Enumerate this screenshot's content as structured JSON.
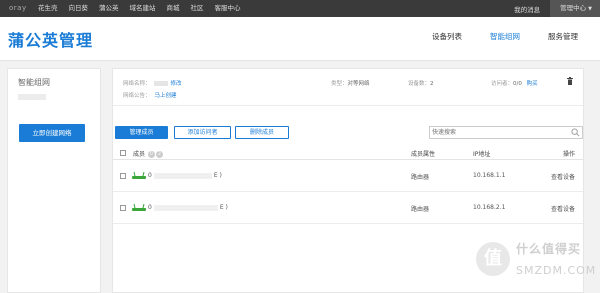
{
  "topbar": {
    "logo": "oray",
    "nav": [
      "花生壳",
      "向日葵",
      "蒲公英",
      "域名建站",
      "商城",
      "社区",
      "客服中心"
    ],
    "my_messages": "我的消息",
    "mgmt_center": "管理中心"
  },
  "header": {
    "title": "蒲公英管理",
    "tabs": [
      "设备列表",
      "智能组网",
      "服务管理"
    ],
    "active_tab": "智能组网"
  },
  "left": {
    "network_name": "智能组网",
    "create_button": "立即创建网络"
  },
  "info": {
    "network_name_label": "网络名称：",
    "edit_link": "修改",
    "announcement_label": "网络公告：",
    "create_now_link": "马上创建",
    "type_label": "类型：",
    "type_value": "对等网络",
    "device_count_label": "设备数：",
    "device_count_value": "2",
    "visitors_label": "访问者：",
    "visitors_value": "0/0",
    "buy_link": "购买"
  },
  "toolbar": {
    "manage_members": "管理成员",
    "add_visitor": "添加访问者",
    "delete_member": "删除成员",
    "search_placeholder": "快速搜索"
  },
  "table": {
    "headers": {
      "member": "成员",
      "badge_1": "0",
      "badge_2": "2",
      "attribute": "成员属性",
      "ip": "IP地址",
      "action": "操作"
    },
    "rows": [
      {
        "id_prefix": "0",
        "id_suffix": "E )",
        "attribute": "路由器",
        "ip": "10.168.1.1",
        "action": "查看设备"
      },
      {
        "id_prefix": "0",
        "id_suffix": "E )",
        "attribute": "路由器",
        "ip": "10.168.2.1",
        "action": "查看设备"
      }
    ]
  },
  "watermark": {
    "line1": "什么值得买",
    "line2": "SMZDM.COM",
    "logo_char": "值"
  },
  "colors": {
    "accent": "#1a7cd6",
    "topbar": "#3a3a3a",
    "router_green": "#3aa63a"
  }
}
